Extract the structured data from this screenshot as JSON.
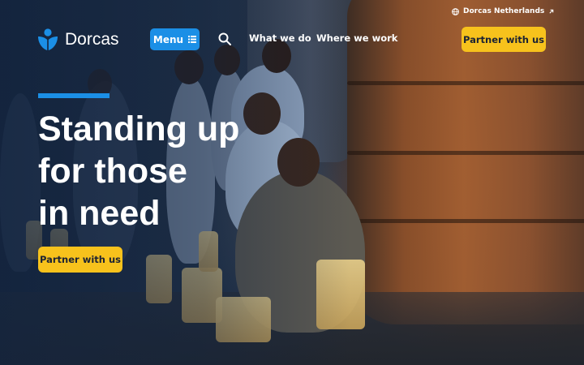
{
  "brand": {
    "name": "Dorcas"
  },
  "header": {
    "menu_label": "Menu",
    "nav": [
      "What we do",
      "Where we work"
    ],
    "region_link": "Dorcas Netherlands",
    "partner_label": "Partner with us"
  },
  "hero": {
    "headline": [
      "Standing up",
      "for those",
      "in need"
    ],
    "cta_label": "Partner with us"
  },
  "colors": {
    "accent_blue": "#1b8fe6",
    "cta_yellow": "#f7c21c"
  },
  "icons": [
    "dorcas-logo-icon",
    "menu-list-icon",
    "search-icon",
    "globe-icon",
    "external-link-icon"
  ]
}
